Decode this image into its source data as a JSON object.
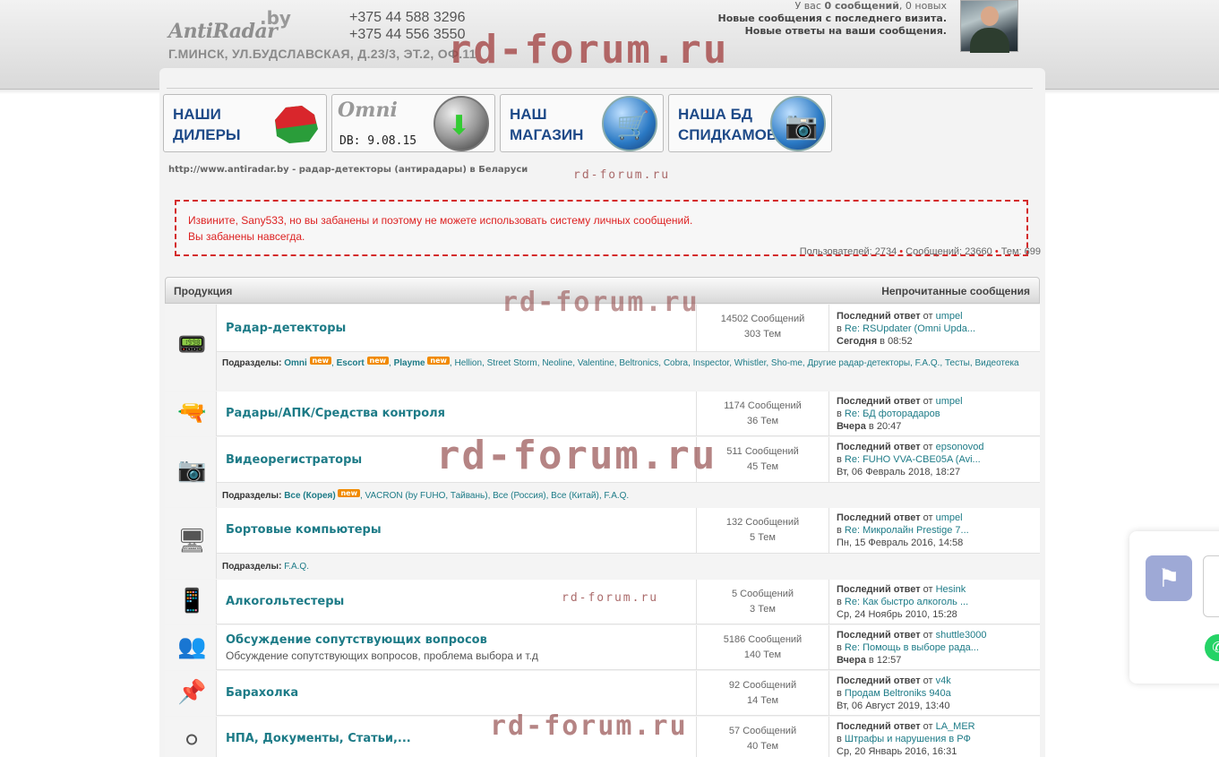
{
  "header": {
    "logo_main": "AntiRadar",
    "logo_tld": ".by",
    "phone1": "+375 44 588 3296",
    "phone2": "+375 44 556 3550",
    "address": "Г.МИНСК, УЛ.БУДСЛАВСКАЯ, Д.23/3, ЭТ.2, ОФ.11",
    "watermark": "rd-forum.ru",
    "user_line1_pre": "У вас ",
    "user_line1_bold": "0 сообщений",
    "user_line1_post": ", 0 новых",
    "user_line2": "Новые сообщения с последнего визита.",
    "user_line3": "Новые ответы на ваши сообщения."
  },
  "banners": [
    {
      "label1": "НАШИ",
      "label2": "ДИЛЕРЫ"
    },
    {
      "logo": "Omni",
      "db": "DB: 9.08.15"
    },
    {
      "label1": "НАШ",
      "label2": "МАГАЗИН"
    },
    {
      "label1": "НАША БД",
      "label2": "СПИДКАМОВ"
    }
  ],
  "site_link": "http://www.antiradar.by - радар-детекторы (антирадары) в Беларуси",
  "watermark_small": "rd-forum.ru",
  "ban": {
    "line1": "Извините, Sany533, но вы забанены и поэтому не можете использовать систему личных сообщений.",
    "line2": "Вы забанены навсегда."
  },
  "stats": {
    "users": "Пользователей: 2734",
    "messages": "Сообщений: 23660",
    "topics": "Тем: 699"
  },
  "table": {
    "col_left": "Продукция",
    "col_right": "Непрочитанные сообщения"
  },
  "forums": [
    {
      "title": "Радар-детекторы",
      "posts": "14502 Сообщений",
      "topics": "303 Тем",
      "last_label": "Последний ответ",
      "from": " от ",
      "user": "umpel",
      "in": "в ",
      "topic": "Re: RSUpdater (Omni Upda...",
      "date_bold": "Сегодня",
      "date_rest": " в 08:52"
    },
    {
      "title": "Радары/АПК/Средства контроля",
      "posts": "1174 Сообщений",
      "topics": "36 Тем",
      "last_label": "Последний ответ",
      "from": " от ",
      "user": "umpel",
      "in": "в ",
      "topic": "Re: БД фоторадаров",
      "date_bold": "Вчера",
      "date_rest": " в 20:47"
    },
    {
      "title": "Видеорегистраторы",
      "posts": "511 Сообщений",
      "topics": "45 Тем",
      "last_label": "Последний ответ",
      "from": " от ",
      "user": "epsonovod",
      "in": "в ",
      "topic": "Re: FUHO VVA-CBE05A (Avi...",
      "date_bold": "",
      "date_rest": "Вт, 06 Февраль 2018, 18:27"
    },
    {
      "title": "Бортовые компьютеры",
      "posts": "132 Сообщений",
      "topics": "5 Тем",
      "last_label": "Последний ответ",
      "from": " от ",
      "user": "umpel",
      "in": "в ",
      "topic": "Re: Микролайн Prestige 7...",
      "date_bold": "",
      "date_rest": "Пн, 15 Февраль 2016, 14:58"
    },
    {
      "title": "Алкогольтестеры",
      "posts": "5 Сообщений",
      "topics": "3 Тем",
      "last_label": "Последний ответ",
      "from": " от ",
      "user": "Hesink",
      "in": "в ",
      "topic": "Re: Как быстро алкоголь ...",
      "date_bold": "",
      "date_rest": "Ср, 24 Ноябрь 2010, 15:28"
    },
    {
      "title": "Обсуждение сопутствующих вопросов",
      "desc": "Обсуждение сопутствующих вопросов, проблема выбора и т.д",
      "posts": "5186 Сообщений",
      "topics": "140 Тем",
      "last_label": "Последний ответ",
      "from": " от ",
      "user": "shuttle3000",
      "in": "в ",
      "topic": "Re: Помощь в выборе рада...",
      "date_bold": "Вчера",
      "date_rest": " в 12:57"
    },
    {
      "title": "Барахолка",
      "posts": "92 Сообщений",
      "topics": "14 Тем",
      "last_label": "Последний ответ",
      "from": " от ",
      "user": "v4k",
      "in": "в ",
      "topic": "Продам Beltroniks 940a",
      "date_bold": "",
      "date_rest": "Вт, 06 Август 2019, 13:40"
    },
    {
      "title": "НПА, Документы, Статьи,...",
      "posts": "57 Сообщений",
      "topics": "40 Тем",
      "last_label": "Последний ответ",
      "from": " от ",
      "user": "LA_MER",
      "in": "в ",
      "topic": "Штрафы и нарушения в РФ",
      "date_bold": "",
      "date_rest": "Ср, 20 Январь 2016, 16:31"
    }
  ],
  "subforums": {
    "label": "Подразделы:",
    "new_badge": "new",
    "radar": [
      "Omni",
      "Escort",
      "Playme",
      "Hellion",
      "Street Storm",
      "Neoline",
      "Valentine",
      "Beltronics",
      "Cobra",
      "Inspector",
      "Whistler",
      "Sho-me",
      "Другие радар-детекторы",
      "F.A.Q.",
      "Тесты",
      "Видеотека"
    ],
    "video": [
      "Все (Корея)",
      "VACRON (by FUHO, Тайвань)",
      "Все (Россия)",
      "Все (Китай)",
      "F.A.Q."
    ],
    "board": [
      "F.A.Q."
    ]
  },
  "colors": {
    "accent": "#1d7b87",
    "ban_red": "#d42b2b",
    "new_badge": "#f18a00",
    "title_blue": "#1e4a88"
  },
  "icons": {
    "flag": "flag-icon",
    "whatsapp": "whatsapp-icon"
  }
}
